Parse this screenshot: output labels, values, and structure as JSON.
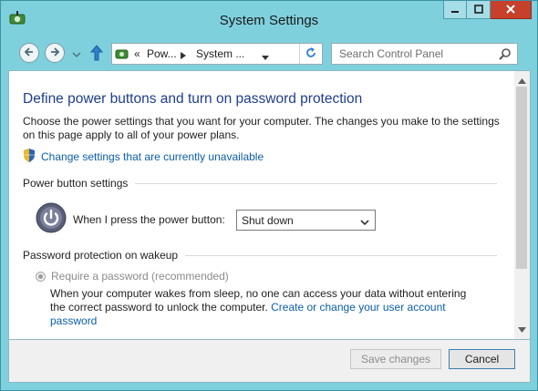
{
  "window": {
    "title": "System Settings",
    "icons": {
      "app": "power-options-icon",
      "minimize": "minimize-icon",
      "maximize": "maximize-icon",
      "close": "close-icon"
    }
  },
  "nav": {
    "address": {
      "overflow": "«",
      "breadcrumbs": [
        "Pow...",
        "System ..."
      ]
    },
    "search": {
      "placeholder": "Search Control Panel"
    },
    "icons": [
      "back-icon",
      "forward-icon",
      "recent-pages-icon",
      "up-icon",
      "refresh-icon",
      "search-icon"
    ]
  },
  "page": {
    "heading": "Define power buttons and turn on password protection",
    "intro": "Choose the power settings that you want for your computer. The changes you make to the settings on this page apply to all of your power plans.",
    "change_link": "Change settings that are currently unavailable",
    "power_section": {
      "label": "Power button settings",
      "prompt": "When I press the power button:",
      "selected": "Shut down"
    },
    "password_section": {
      "label": "Password protection on wakeup",
      "option_label": "Require a password (recommended)",
      "description": "When your computer wakes from sleep, no one can access your data without entering the correct password to unlock the computer.",
      "account_link": "Create or change your user account password"
    }
  },
  "footer": {
    "save_label": "Save changes",
    "cancel_label": "Cancel"
  },
  "colors": {
    "titlebar": "#7fd0dd",
    "heading": "#1e3d8f",
    "link": "#0b5ea8",
    "close_button": "#c7402b"
  }
}
